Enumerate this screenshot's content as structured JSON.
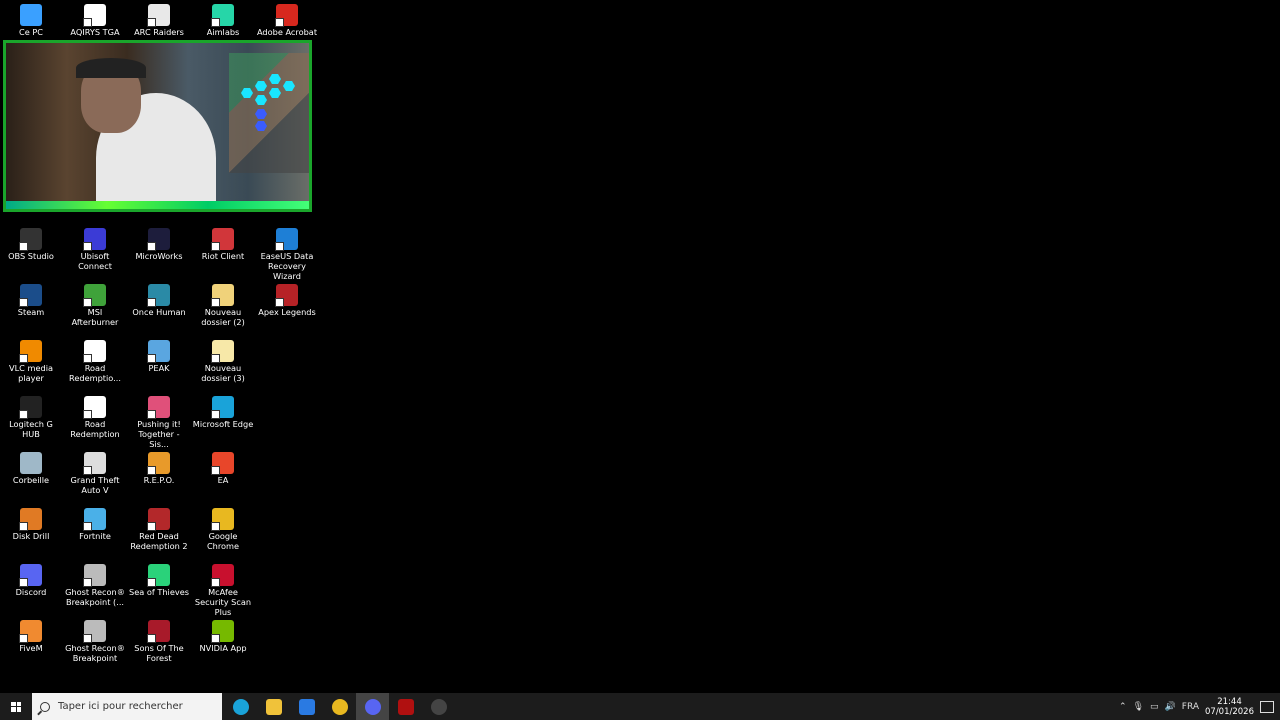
{
  "desktop_icons": [
    {
      "label": "Ce PC",
      "icon": "pc-icon",
      "color": "#3aa0ff"
    },
    {
      "label": "AQIRYS TGA",
      "icon": "aqirys-icon",
      "color": "#ffffff"
    },
    {
      "label": "ARC Raiders",
      "icon": "file-icon",
      "color": "#e8e8e8"
    },
    {
      "label": "Aimlabs",
      "icon": "aimlabs-icon",
      "color": "#26d6a8"
    },
    {
      "label": "Adobe Acrobat",
      "icon": "acrobat-icon",
      "color": "#d7281e"
    },
    {
      "label": "OBS Studio",
      "icon": "obs-icon",
      "color": "#333333"
    },
    {
      "label": "Ubisoft Connect",
      "icon": "ubisoft-icon",
      "color": "#3b3bd6"
    },
    {
      "label": "MicroWorks",
      "icon": "microworks-icon",
      "color": "#1d1d3c"
    },
    {
      "label": "Riot Client",
      "icon": "riot-icon",
      "color": "#d1363a"
    },
    {
      "label": "EaseUS Data Recovery Wizard",
      "icon": "easeus-icon",
      "color": "#1e7fd6"
    },
    {
      "label": "Steam",
      "icon": "steam-icon",
      "color": "#1b4d8a"
    },
    {
      "label": "MSI Afterburner",
      "icon": "afterburner-icon",
      "color": "#3fa23a"
    },
    {
      "label": "Once Human",
      "icon": "oncehuman-icon",
      "color": "#2a8aa6"
    },
    {
      "label": "Nouveau dossier (2)",
      "icon": "folder-icon",
      "color": "#f0d27a"
    },
    {
      "label": "Apex Legends",
      "icon": "apex-icon",
      "color": "#b62226"
    },
    {
      "label": "VLC media player",
      "icon": "vlc-icon",
      "color": "#f08a00"
    },
    {
      "label": "Road Redemptio...",
      "icon": "road-redemption-icon",
      "color": "#ffffff"
    },
    {
      "label": "PEAK",
      "icon": "peak-icon",
      "color": "#5aa6e0"
    },
    {
      "label": "Nouveau dossier (3)",
      "icon": "folder-icon",
      "color": "#f7e8a8"
    },
    {
      "label": "Logitech G HUB",
      "icon": "ghub-icon",
      "color": "#222222"
    },
    {
      "label": "Road Redemption",
      "icon": "road-redemption-icon",
      "color": "#ffffff"
    },
    {
      "label": "Pushing it! Together - Sis...",
      "icon": "pushing-icon",
      "color": "#e0507a"
    },
    {
      "label": "Microsoft Edge",
      "icon": "edge-icon",
      "color": "#1aa3d9"
    },
    {
      "label": "Corbeille",
      "icon": "recycle-bin-icon",
      "color": "#9fb8c8"
    },
    {
      "label": "Grand Theft Auto V",
      "icon": "gta-icon",
      "color": "#dddddd"
    },
    {
      "label": "R.E.P.O.",
      "icon": "repo-icon",
      "color": "#e89a2a"
    },
    {
      "label": "EA",
      "icon": "ea-icon",
      "color": "#e8462a"
    },
    {
      "label": "Disk Drill",
      "icon": "diskdrill-icon",
      "color": "#e07a24"
    },
    {
      "label": "Fortnite",
      "icon": "fortnite-icon",
      "color": "#4ab0e8"
    },
    {
      "label": "Red Dead Redemption 2",
      "icon": "rdr2-icon",
      "color": "#b3282a"
    },
    {
      "label": "Google Chrome",
      "icon": "chrome-icon",
      "color": "#e8b820"
    },
    {
      "label": "Discord",
      "icon": "discord-icon",
      "color": "#5865f2"
    },
    {
      "label": "Ghost Recon® Breakpoint (...",
      "icon": "ghost-recon-icon",
      "color": "#bbbbbb"
    },
    {
      "label": "Sea of Thieves",
      "icon": "seaofthieves-icon",
      "color": "#2ad27a"
    },
    {
      "label": "McAfee Security Scan Plus",
      "icon": "mcafee-icon",
      "color": "#c8102e"
    },
    {
      "label": "FiveM",
      "icon": "fivem-icon",
      "color": "#f08a30"
    },
    {
      "label": "Ghost Recon® Breakpoint",
      "icon": "ghost-recon-icon",
      "color": "#bbbbbb"
    },
    {
      "label": "Sons Of The Forest",
      "icon": "sonsforest-icon",
      "color": "#a81a2a"
    },
    {
      "label": "NVIDIA App",
      "icon": "nvidia-icon",
      "color": "#76b900"
    }
  ],
  "taskbar": {
    "search_placeholder": "Taper ici pour rechercher",
    "apps": [
      {
        "name": "edge",
        "icon": "edge-icon",
        "color": "#1aa3d9",
        "active": false
      },
      {
        "name": "explorer",
        "icon": "folder-icon",
        "color": "#f0c23a",
        "active": false
      },
      {
        "name": "store",
        "icon": "store-icon",
        "color": "#2a7ae2",
        "active": false
      },
      {
        "name": "chrome",
        "icon": "chrome-icon",
        "color": "#e8b820",
        "active": false
      },
      {
        "name": "discord",
        "icon": "discord-icon",
        "color": "#5865f2",
        "active": true
      },
      {
        "name": "voicemeeter",
        "icon": "voicemeeter-icon",
        "color": "#b01010",
        "active": false
      },
      {
        "name": "obs",
        "icon": "obs-icon",
        "color": "#444444",
        "active": false
      }
    ],
    "tray": {
      "language": "FRA",
      "time": "21:44",
      "date": "07/01/2026"
    }
  }
}
